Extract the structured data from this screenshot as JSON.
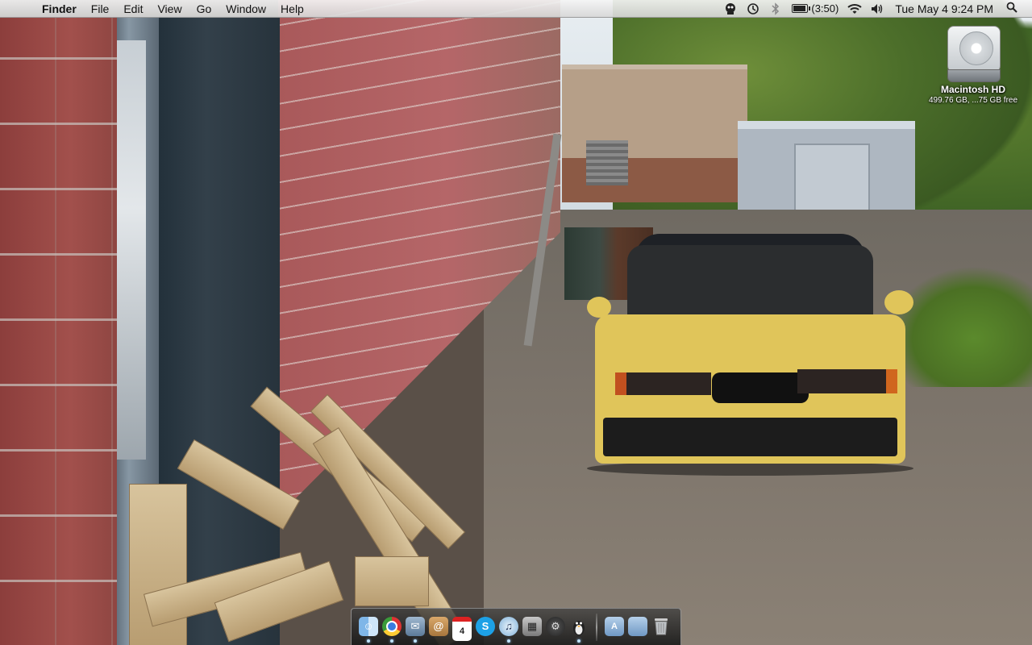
{
  "menubar": {
    "app_name": "Finder",
    "menus": [
      "File",
      "Edit",
      "View",
      "Go",
      "Window",
      "Help"
    ],
    "status": {
      "battery_text": "(3:50)",
      "clock": "Tue May 4  9:24 PM"
    },
    "status_icons": [
      "app-status-icon",
      "time-machine-icon",
      "bluetooth-icon",
      "battery-icon",
      "wifi-icon",
      "volume-icon",
      "spotlight-icon"
    ]
  },
  "desktop": {
    "hard_drive": {
      "label": "Macintosh HD",
      "info": "499.76 GB, ...75 GB free"
    }
  },
  "dock": {
    "apps": [
      {
        "icon": "finder-icon",
        "running": true
      },
      {
        "icon": "chrome-icon",
        "running": true
      },
      {
        "icon": "mail-icon",
        "running": true
      },
      {
        "icon": "address-book-icon",
        "running": false
      },
      {
        "icon": "ical-icon",
        "text": "4",
        "running": false
      },
      {
        "icon": "skype-icon",
        "running": false
      },
      {
        "icon": "itunes-icon",
        "running": true
      },
      {
        "icon": "screenshot-icon",
        "running": false
      },
      {
        "icon": "system-preferences-icon",
        "running": false
      },
      {
        "icon": "adium-icon",
        "running": true
      }
    ],
    "right": [
      {
        "icon": "applications-folder-icon"
      },
      {
        "icon": "documents-folder-icon"
      },
      {
        "icon": "trash-icon"
      }
    ]
  }
}
